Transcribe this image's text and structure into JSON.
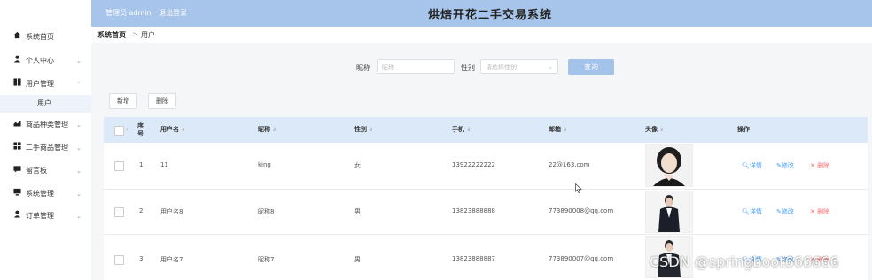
{
  "header": {
    "user_text": "管理员 admin",
    "logout": "退出登录",
    "title": "烘焙开花二手交易系统"
  },
  "breadcrumb": {
    "home": "系统首页",
    "sep": ">",
    "current": "用户"
  },
  "sidebar": {
    "items": [
      {
        "label": "系统首页",
        "icon": "home-icon",
        "glyph": "▲",
        "chevron": ""
      },
      {
        "label": "个人中心",
        "icon": "person-icon",
        "glyph": "●",
        "chevron": "⌄"
      },
      {
        "label": "用户管理",
        "icon": "grid-icon",
        "glyph": "■",
        "chevron": "⌃"
      },
      {
        "label": "用户",
        "icon": "",
        "glyph": "",
        "chevron": ""
      },
      {
        "label": "商品种类管理",
        "icon": "chart-icon",
        "glyph": "◢",
        "chevron": "⌄"
      },
      {
        "label": "二手商品管理",
        "icon": "grid-icon",
        "glyph": "■",
        "chevron": "⌄"
      },
      {
        "label": "留言板",
        "icon": "message-icon",
        "glyph": "▬",
        "chevron": "⌄"
      },
      {
        "label": "系统管理",
        "icon": "monitor-icon",
        "glyph": "▬",
        "chevron": "⌄"
      },
      {
        "label": "订单管理",
        "icon": "person-icon",
        "glyph": "●",
        "chevron": "⌄"
      }
    ]
  },
  "search": {
    "nickname_label": "昵称",
    "nickname_placeholder": "昵称",
    "gender_label": "性别",
    "gender_placeholder": "请选择性别",
    "query_button": "查询"
  },
  "actions": {
    "add": "新增",
    "delete": "删除"
  },
  "table": {
    "headers": {
      "no": "序号",
      "username": "用户名",
      "nickname": "昵称",
      "gender": "性别",
      "phone": "手机",
      "email": "邮箱",
      "avatar": "头像",
      "ops": "操作"
    },
    "ops": {
      "detail": "详情",
      "edit": "修改",
      "delete": "删除"
    },
    "rows": [
      {
        "no": "1",
        "username": "11",
        "nickname": "king",
        "gender": "女",
        "phone": "13922222222",
        "email": "22@163.com"
      },
      {
        "no": "2",
        "username": "用户名8",
        "nickname": "昵称8",
        "gender": "男",
        "phone": "13823888888",
        "email": "773890008@qq.com"
      },
      {
        "no": "3",
        "username": "用户名7",
        "nickname": "昵称7",
        "gender": "男",
        "phone": "13823888887",
        "email": "773890007@qq.com"
      }
    ]
  },
  "watermark": "CSDN @springboot666666",
  "colors": {
    "header_bg": "#a7c4ea",
    "table_header_bg": "#dce9f9",
    "link_blue": "#409eff",
    "danger_red": "#f56c6c"
  }
}
